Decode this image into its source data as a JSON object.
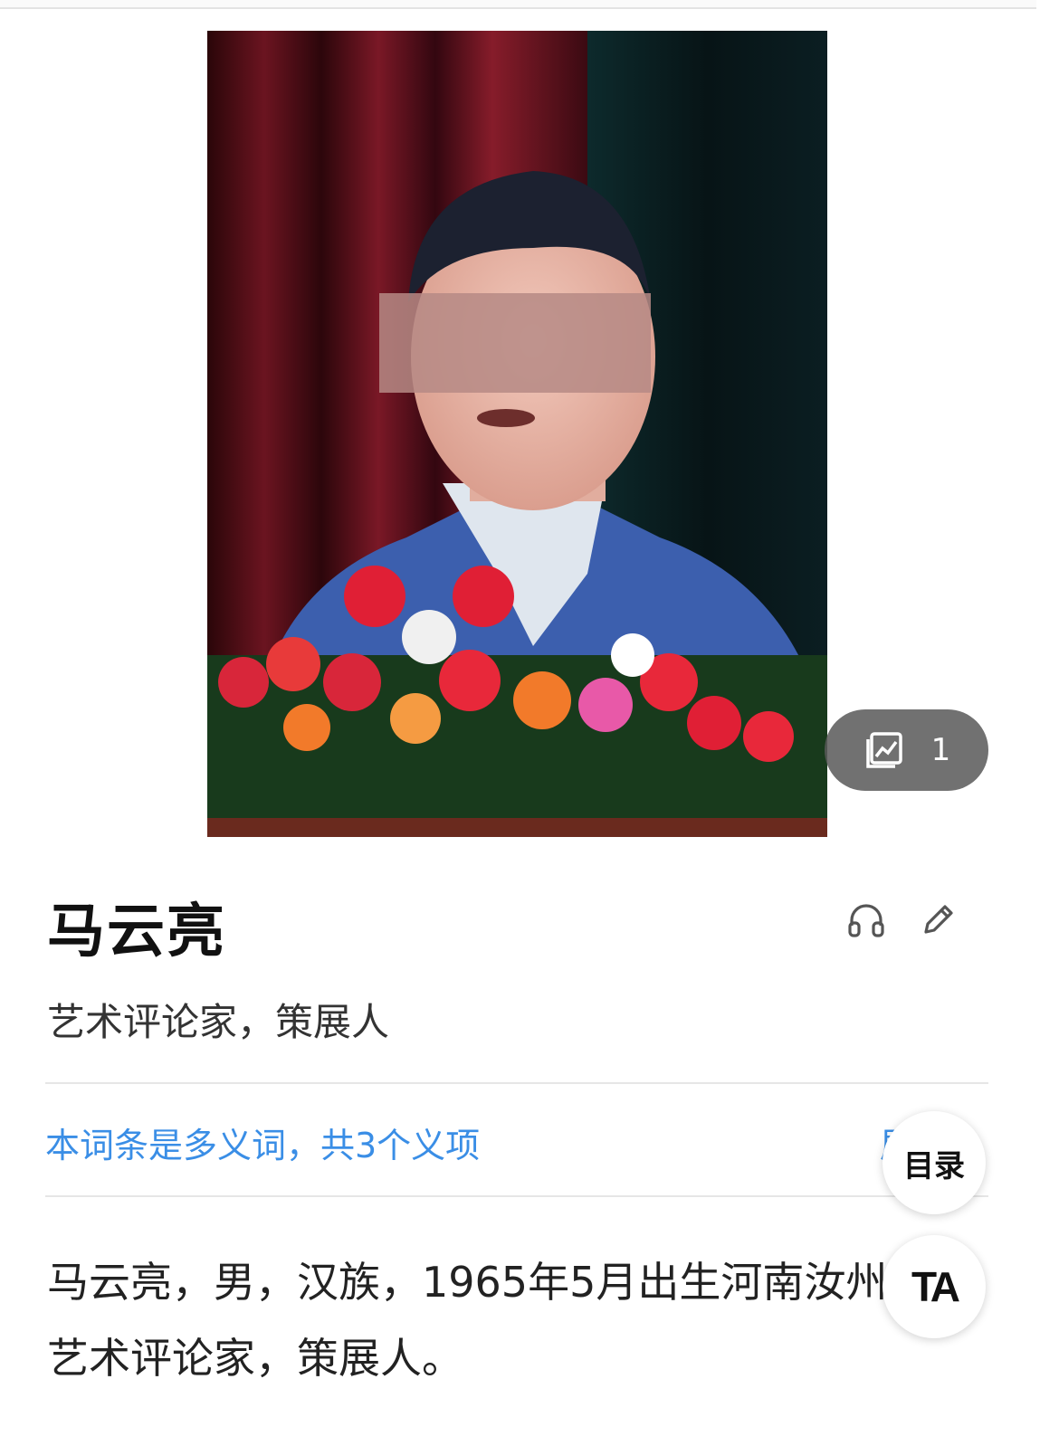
{
  "hero": {
    "image_alt": "人物照片",
    "album_count": "1",
    "colors": {
      "curtain_red": "#5c0f1a",
      "curtain_dark": "#0e1414",
      "jacket": "#3c5fae",
      "chip_bg": "#5a5a5a"
    }
  },
  "entry": {
    "title": "马云亮",
    "subtitle": "艺术评论家，策展人",
    "icons": [
      "headphones-icon",
      "edit-pencil-icon"
    ]
  },
  "polysemy": {
    "notice": "本词条是多义词，共3个义项",
    "expand_label": "展开"
  },
  "summary": {
    "text": "马云亮，男，汉族，1965年5月出生河南汝州，艺术评论家，策展人。"
  },
  "floating": {
    "toc_label": "目录",
    "ta_label": "TA"
  },
  "accent_color": "#3a8ee6"
}
